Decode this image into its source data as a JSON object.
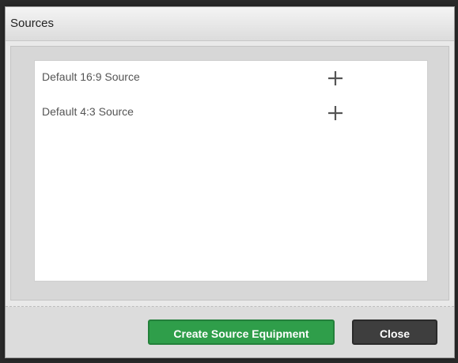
{
  "dialog": {
    "title": "Sources"
  },
  "sources": {
    "items": [
      {
        "label": "Default 16:9 Source",
        "action_icon": "plus-icon"
      },
      {
        "label": "Default 4:3 Source",
        "action_icon": "plus-icon"
      }
    ]
  },
  "footer": {
    "create_label": "Create Source Equipment",
    "close_label": "Close"
  },
  "colors": {
    "create_button": "#2f9e4a",
    "close_button": "#3e3e3e"
  }
}
